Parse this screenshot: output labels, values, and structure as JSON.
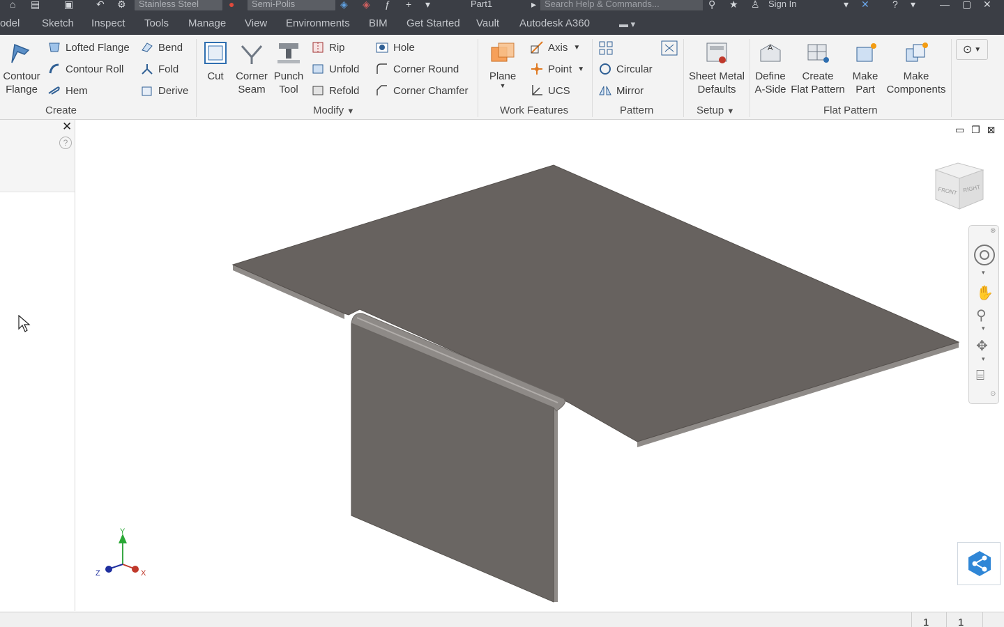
{
  "titlebar": {
    "material": "Stainless Steel",
    "appearance": "Semi-Polis",
    "document": "Part1",
    "search_placeholder": "Search Help & Commands...",
    "sign_in": "Sign In"
  },
  "tabs": [
    "odel",
    "Sketch",
    "Inspect",
    "Tools",
    "Manage",
    "View",
    "Environments",
    "BIM",
    "Get Started",
    "Vault",
    "Autodesk A360"
  ],
  "ribbon": {
    "create": {
      "contour_flange": "Contour\nFlange",
      "lofted_flange": "Lofted Flange",
      "contour_roll": "Contour Roll",
      "hem": "Hem",
      "bend": "Bend",
      "fold": "Fold",
      "derive": "Derive",
      "label": "Create"
    },
    "modify": {
      "cut": "Cut",
      "corner_seam": "Corner\nSeam",
      "punch_tool": "Punch\nTool",
      "rip": "Rip",
      "unfold": "Unfold",
      "refold": "Refold",
      "hole": "Hole",
      "corner_round": "Corner Round",
      "corner_chamfer": "Corner Chamfer",
      "label": "Modify"
    },
    "work_features": {
      "plane": "Plane",
      "axis": "Axis",
      "point": "Point",
      "ucs": "UCS",
      "label": "Work Features"
    },
    "pattern": {
      "circular": "Circular",
      "mirror": "Mirror",
      "label": "Pattern"
    },
    "setup": {
      "sheet_metal_defaults": "Sheet Metal\nDefaults",
      "label": "Setup"
    },
    "flat_pattern": {
      "define_a_side": "Define\nA-Side",
      "create_flat_pattern": "Create\nFlat Pattern",
      "make_part": "Make\nPart",
      "make_components": "Make\nComponents",
      "label": "Flat Pattern"
    }
  },
  "viewcube": {
    "front": "FRONT",
    "right": "RIGHT"
  },
  "triad": {
    "x": "X",
    "y": "Y",
    "z": "Z"
  },
  "statusbar": {
    "cell1": "1",
    "cell2": "1"
  },
  "colors": {
    "sheet_top": "#67625f",
    "sheet_edge": "#8d8986",
    "flange": "#6a6663",
    "ribbon_bg": "#f3f3f3",
    "dark_bar": "#3b3e45"
  }
}
